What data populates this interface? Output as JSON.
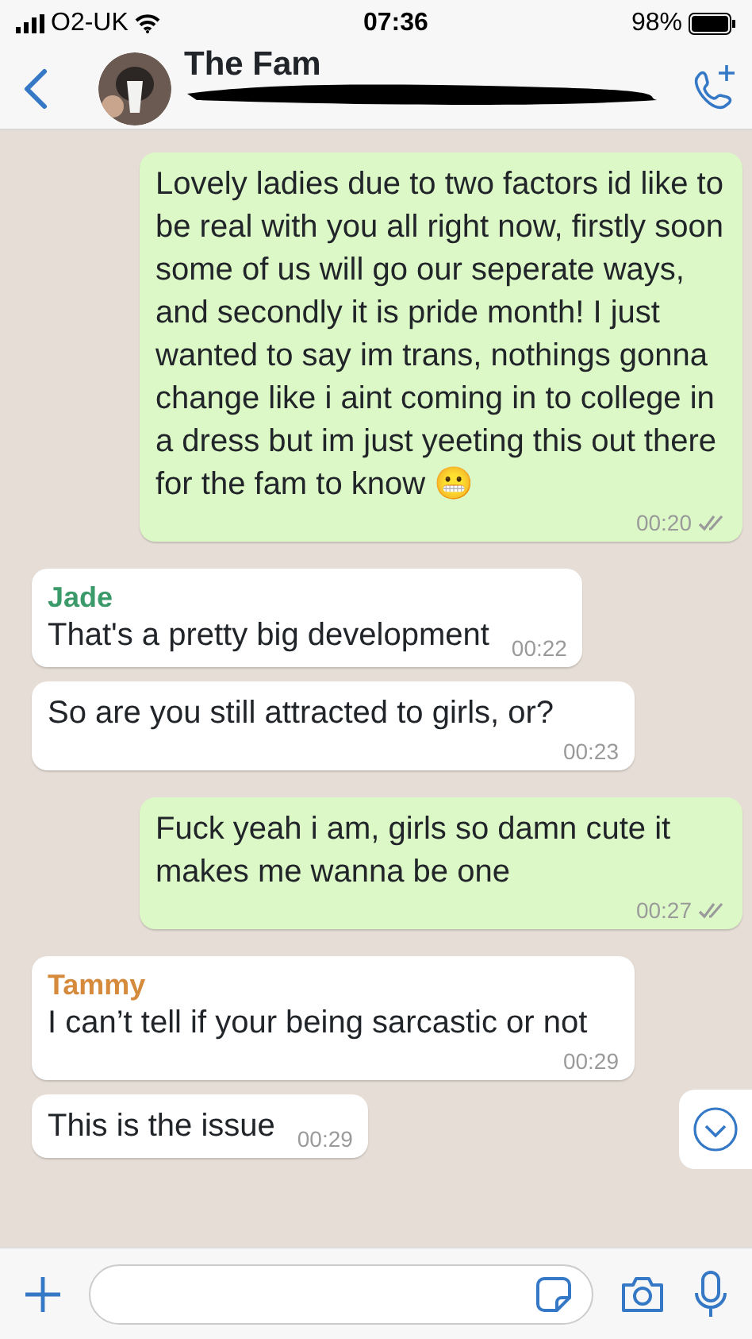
{
  "status_bar": {
    "carrier": "O2-UK",
    "time": "07:36",
    "battery": "98%"
  },
  "header": {
    "title": "The Fam"
  },
  "messages": [
    {
      "kind": "outgoing",
      "text": "Lovely ladies due to two factors id like to be real with you all right now, firstly soon some of us will go our seperate ways, and secondly it is pride month! I just wanted to say im trans, nothings gonna change like i aint coming in to college in a dress but im just yeeting this out there for the fam to know 😬",
      "time": "00:20",
      "read": false
    },
    {
      "kind": "incoming",
      "sender": "Jade",
      "color": "#3a9a6a",
      "text": "That's a pretty big development",
      "time": "00:22"
    },
    {
      "kind": "incoming",
      "text": "So are you still attracted to girls, or?",
      "time": "00:23"
    },
    {
      "kind": "outgoing",
      "text": "Fuck yeah i am, girls so damn cute it makes me wanna be one",
      "time": "00:27",
      "read": false
    },
    {
      "kind": "incoming",
      "sender": "Tammy",
      "color": "#d58a3c",
      "text": "I can’t tell if your being sarcastic or not",
      "time": "00:29"
    },
    {
      "kind": "incoming",
      "text": "This is the issue",
      "time": "00:29"
    }
  ]
}
